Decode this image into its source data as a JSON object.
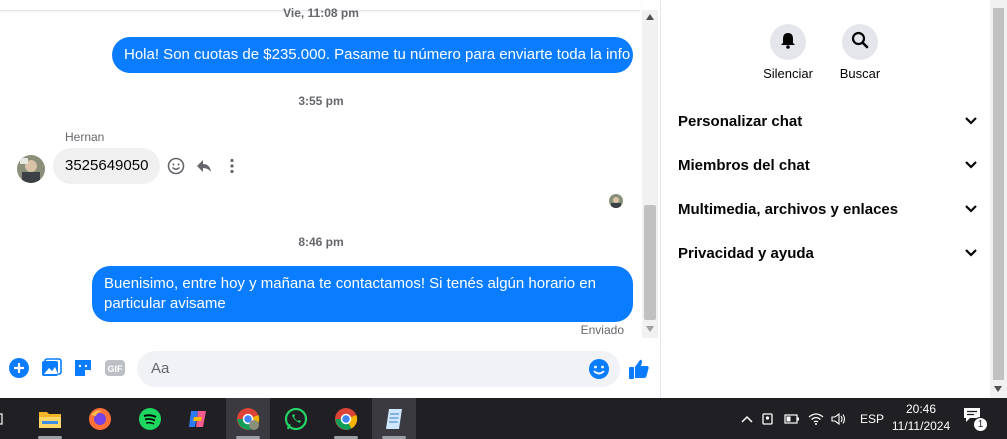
{
  "chat": {
    "timestamps": [
      "Vie, 11:08 pm",
      "3:55 pm",
      "8:46 pm"
    ],
    "messages": [
      {
        "from": "me",
        "text": "Hola! Son cuotas de $235.000. Pasame tu número para enviarte toda la info"
      },
      {
        "from": "Hernan",
        "text": "3525649050"
      },
      {
        "from": "me",
        "text": "Buenisimo, entre hoy y mañana te contactamos! Si tenés algún horario en particular avisame"
      }
    ],
    "sender_name": "Hernan",
    "status": "Enviado",
    "composer": {
      "placeholder": "Aa"
    }
  },
  "sidebar": {
    "buttons": [
      {
        "label": "Silenciar",
        "icon": "bell-icon"
      },
      {
        "label": "Buscar",
        "icon": "search-icon"
      }
    ],
    "sections": [
      {
        "label": "Personalizar chat"
      },
      {
        "label": "Miembros del chat"
      },
      {
        "label": "Multimedia, archivos y enlaces"
      },
      {
        "label": "Privacidad y ayuda"
      }
    ]
  },
  "taskbar": {
    "language": "ESP",
    "time": "20:46",
    "date": "11/11/2024",
    "notifications": "1"
  },
  "colors": {
    "accent": "#0a7cff",
    "taskbar": "#1f1f24"
  }
}
